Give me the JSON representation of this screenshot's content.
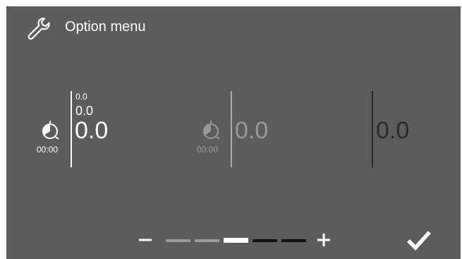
{
  "header": {
    "title": "Option menu",
    "icon": "wrench-icon"
  },
  "columns": [
    {
      "timer_label": "00:00",
      "values": [
        "0.0",
        "0.0",
        "0.0"
      ],
      "state": "active",
      "color": "#ffffff"
    },
    {
      "timer_label": "00:00",
      "values": [
        "0.0"
      ],
      "state": "dimmed",
      "color": "#999999"
    },
    {
      "values": [
        "0.0"
      ],
      "state": "inactive",
      "color": "#2a2a2a"
    }
  ],
  "level_control": {
    "minus_label": "−",
    "plus_label": "+",
    "segments": 5,
    "current_level": 3,
    "colors": {
      "filled": "#9a9a9a",
      "current": "#ffffff",
      "empty": "#111111"
    }
  },
  "confirm": {
    "icon": "checkmark-icon"
  },
  "colors": {
    "background": "#5c5c5c"
  }
}
